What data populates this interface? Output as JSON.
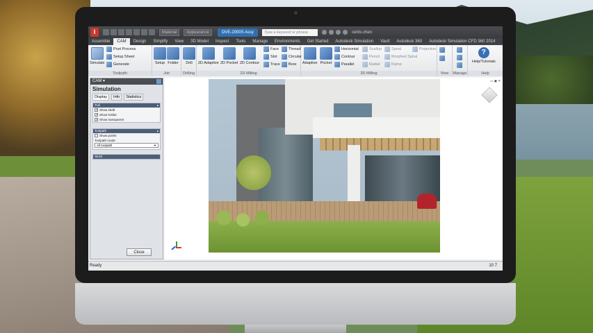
{
  "window": {
    "material_combo": "Material",
    "appearance_combo": "Appearance",
    "document_tab": "OVE-2000S Assy",
    "search_placeholder": "Type a keyword or phrase",
    "signin": "certis.chen",
    "app_icon_letter": "I"
  },
  "menu": {
    "tabs": [
      "Assemble",
      "CAM",
      "Design",
      "Simplify",
      "View",
      "3D Model",
      "Inspect",
      "Tools",
      "Manage",
      "Environments",
      "Get Started",
      "Autodesk Simulation",
      "Vault",
      "Autodesk 360",
      "Autodesk Simulation CFD 360 2014"
    ],
    "active_index": 1
  },
  "ribbon": {
    "toolpath": {
      "title": "Toolpath",
      "simulate": "Simulate",
      "post_process": "Post Process",
      "setup_sheet": "Setup Sheet",
      "generate": "Generate"
    },
    "job": {
      "title": "Job",
      "setup": "Setup",
      "folder": "Folder"
    },
    "drilling": {
      "title": "Drilling",
      "drill": "Drill"
    },
    "milling2d": {
      "title": "2D Milling",
      "adaptive": "2D Adaptive",
      "pocket": "2D Pocket",
      "contour": "2D Contour",
      "face": "Face",
      "slot": "Slot",
      "trace": "Trace",
      "thread": "Thread",
      "circular": "Circular",
      "bore": "Bore"
    },
    "milling3d": {
      "title": "3D Milling",
      "adaptive": "Adaptive",
      "pocket": "Pocket",
      "horizontal": "Horizontal",
      "contour": "Contour",
      "parallel": "Parallel",
      "scallop": "Scallop",
      "pencil": "Pencil",
      "radial": "Radial",
      "spiral": "Spiral",
      "morphed_spiral": "Morphed Spiral",
      "ramp": "Ramp",
      "projection": "Projection"
    },
    "view": {
      "title": "View"
    },
    "manage": {
      "title": "Manage"
    },
    "help": {
      "title": "Help",
      "label": "Help/Tutorials"
    }
  },
  "browser": {
    "header": "CAM ▾",
    "title": "Simulation",
    "tabs": [
      "Display",
      "Info",
      "Statistics"
    ],
    "tool_section": "Tool",
    "tool_options": [
      {
        "label": "Show shaft",
        "checked": true
      },
      {
        "label": "Show holder",
        "checked": true
      },
      {
        "label": "Show transparent",
        "checked": true
      }
    ],
    "toolpath_section": "Toolpath",
    "show_points": "Show points",
    "toolpath_mode_label": "Toolpath mode:",
    "toolpath_mode_value": "All toolpath",
    "stock_section": "Stock",
    "close_label": "Close"
  },
  "statusbar": {
    "text": "Ready",
    "counts": "10   7"
  },
  "colors": {
    "accent": "#3c73b8",
    "titlebar": "#393b3e",
    "active_doc": "#2f6fb0"
  }
}
